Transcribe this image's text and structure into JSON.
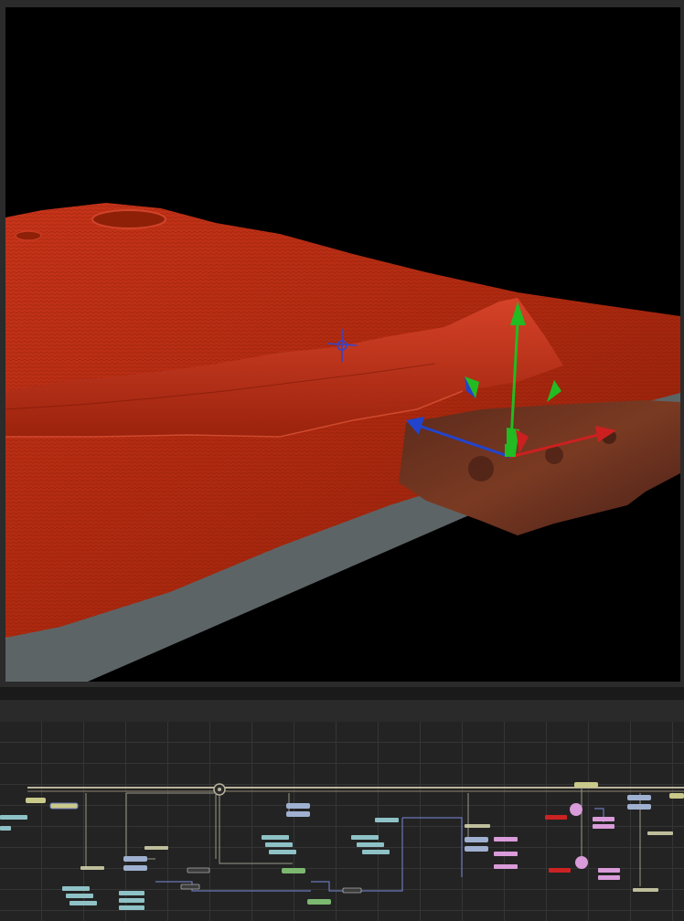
{
  "viewer": {
    "background_color": "#000000",
    "terrain_color": "#b62a10",
    "ground_plane_color": "#5d6466",
    "gizmo": {
      "x_axis_color": "#cc2020",
      "y_axis_color": "#22bb22",
      "z_axis_color": "#2244cc",
      "pivot_icon": "crosshair-icon",
      "tool_icon": "transform-gizmo-icon"
    }
  },
  "node_editor": {
    "background_color": "#232323",
    "grid_color": "#353535",
    "pipe_color": "#b8b29a",
    "node_colors": {
      "loader": "#c9c98a",
      "transform": "#9fb0d0",
      "merge": "#8ec2c6",
      "material": "#d99bd9",
      "error": "#cc2222",
      "green": "#7cb870",
      "hatched": "#d8d8b0"
    },
    "icons": [
      "gear-icon"
    ]
  }
}
